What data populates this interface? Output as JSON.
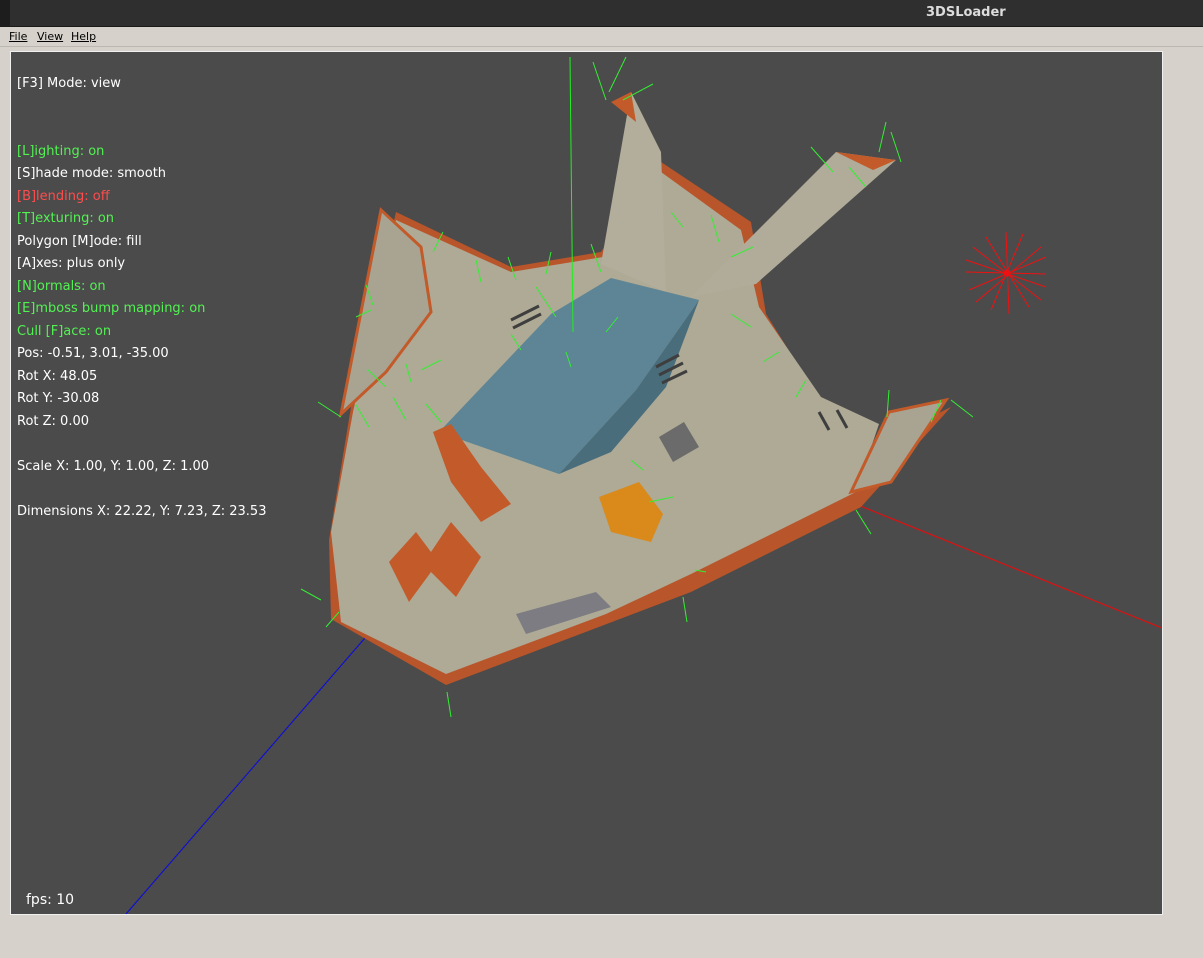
{
  "window": {
    "title": "3DSLoader"
  },
  "menu": {
    "items": [
      {
        "label": "File"
      },
      {
        "label": "View"
      },
      {
        "label": "Help"
      }
    ]
  },
  "colors": {
    "status_on": "#52f252",
    "status_off": "#ff4c4c",
    "text": "#ffffff",
    "viewport_bg": "#4b4b4b",
    "hull": "#aeaa96",
    "trim": "#c25a2a",
    "canopy": "#5d8595",
    "normals": "#33ee33",
    "axis_x": "#dd1111",
    "axis_y": "#22ee22",
    "axis_z": "#1111cc",
    "light": "#ee1111"
  },
  "hud": {
    "mode": "[F3] Mode: view",
    "lighting": "[L]ighting: on",
    "shade_mode": "[S]hade mode: smooth",
    "blending": "[B]lending: off",
    "texturing": "[T]exturing: on",
    "polygon_mode": "Polygon [M]ode: fill",
    "axes": "[A]xes: plus only",
    "normals": "[N]ormals: on",
    "emboss": "[E]mboss bump mapping: on",
    "cull_face": "Cull [F]ace: on",
    "pos": "Pos: -0.51, 3.01, -35.00",
    "rot_x": "Rot X: 48.05",
    "rot_y": "Rot Y: -30.08",
    "rot_z": "Rot Z: 0.00",
    "scale": "Scale X: 1.00, Y: 1.00, Z: 1.00",
    "dimensions": "Dimensions X: 22.22, Y: 7.23, Z: 23.53"
  },
  "fps": "fps: 10"
}
